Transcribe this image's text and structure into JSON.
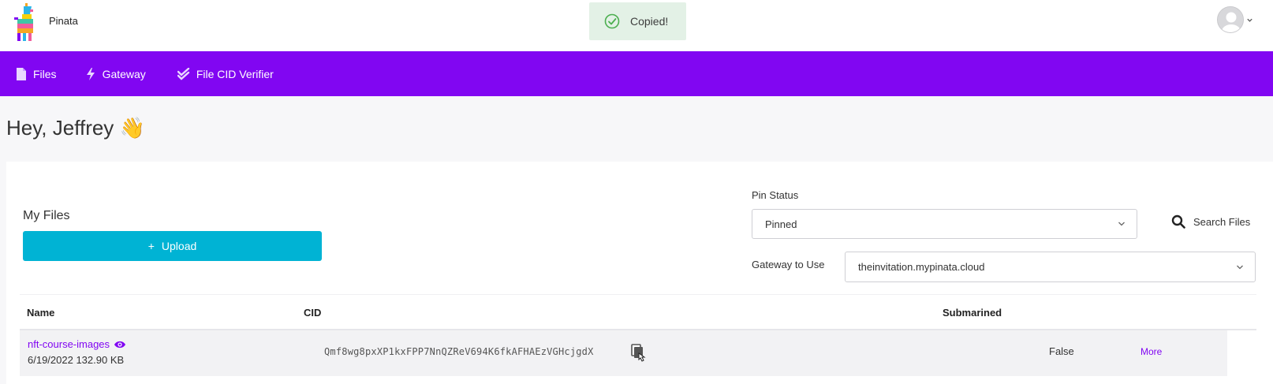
{
  "header": {
    "brand": "Pinata",
    "toast": "Copied!"
  },
  "nav": {
    "items": [
      {
        "label": "Files",
        "icon": "file-icon"
      },
      {
        "label": "Gateway",
        "icon": "lightning-icon"
      },
      {
        "label": "File CID Verifier",
        "icon": "double-check-icon"
      }
    ]
  },
  "greeting": "Hey, Jeffrey 👋",
  "files": {
    "title": "My Files",
    "upload_label": "Upload",
    "pin_status_label": "Pin Status",
    "pin_status_value": "Pinned",
    "search_label": "Search Files",
    "gateway_label": "Gateway to Use",
    "gateway_value": "theinvitation.mypinata.cloud",
    "columns": [
      "Name",
      "CID",
      "Submarined"
    ],
    "rows": [
      {
        "name": "nft-course-images",
        "meta": "6/19/2022 132.90 KB",
        "cid": "Qmf8wg8pxXP1kxFPP7NnQZReV694K6fkAFHAEzVGHcjgdX",
        "submarined": "False",
        "more": "More"
      }
    ]
  },
  "colors": {
    "brand_purple": "#8106f2",
    "upload_blue": "#00b3d4",
    "toast_green": "#e3f1e6"
  }
}
